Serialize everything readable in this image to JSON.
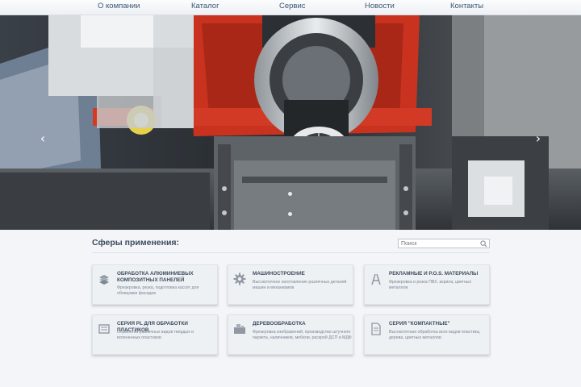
{
  "nav": {
    "items": [
      "О компании",
      "Каталог",
      "Сервис",
      "Новости",
      "Контакты"
    ]
  },
  "slider": {
    "prev_label": "‹",
    "next_label": "›"
  },
  "section": {
    "title": "Сферы применения:"
  },
  "search": {
    "placeholder": "Поиск"
  },
  "cards": [
    {
      "icon": "panels-stack-icon",
      "title": "Обработка алюминиевых композитных панелей",
      "desc": "Фрезеровка, резка, подготовка кассет для облицовки фасадов"
    },
    {
      "icon": "gear-icon",
      "title": "Машиностроение",
      "desc": "Высокоточное изготовление различных деталей машин и механизмов"
    },
    {
      "icon": "easel-icon",
      "title": "Рекламные и P.O.S. материалы",
      "desc": "Фрезеровка и резка ПВХ, акрила, цветных металлов"
    },
    {
      "icon": "panel-icon",
      "title": "Серия PL для обработки пластиков",
      "desc": "Обработка различных видов твердых и вспененных пластиков"
    },
    {
      "icon": "wood-machine-icon",
      "title": "Деревообработка",
      "desc": "Фрезеровка изображений, производство штучного паркета, наличников, мебели, раскрой ДСП и МДФ"
    },
    {
      "icon": "document-icon",
      "title": "Серия \"Компактные\"",
      "desc": "Высокоточная обработка всех видов пластика, дерева, цветных металлов"
    }
  ],
  "colors": {
    "nav_text": "#3b5573",
    "card_bg": "#eef1f4",
    "page_bg": "#f3f5f8",
    "accent_red": "#c8321f"
  }
}
